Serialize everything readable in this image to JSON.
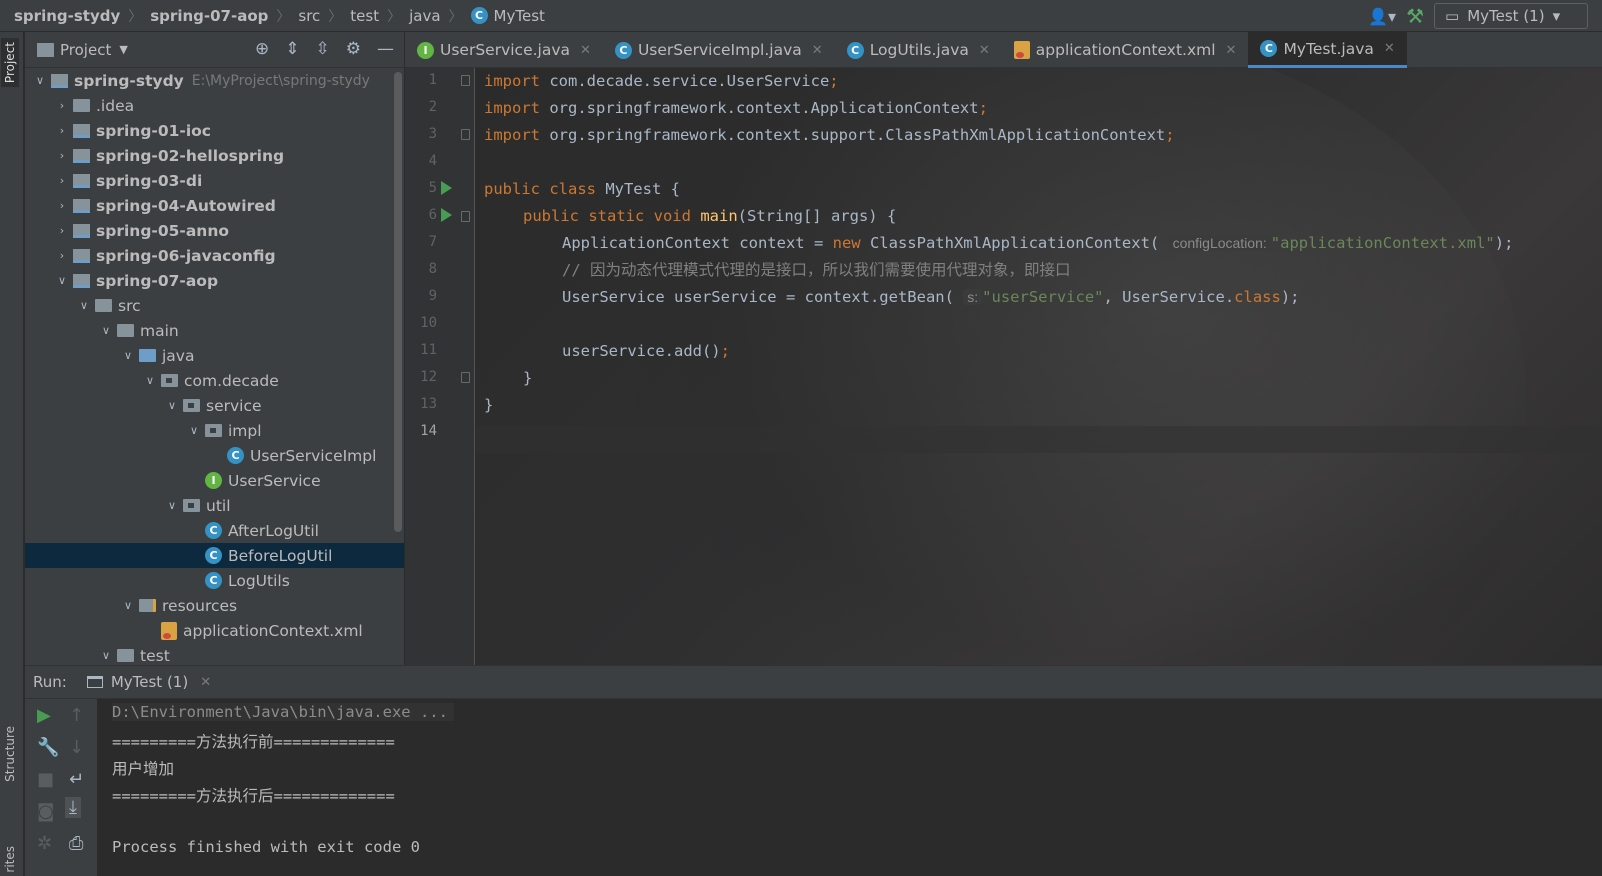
{
  "breadcrumb": {
    "items": [
      "spring-stydy",
      "spring-07-aop",
      "src",
      "test",
      "java",
      "MyTest"
    ]
  },
  "toolbar": {
    "run_config": "MyTest (1)",
    "accent_green": "#59a869"
  },
  "tool_strip": {
    "project_tab": "Project",
    "structure_tab": "Structure",
    "favorites_tab": "rites"
  },
  "project_panel": {
    "title": "Project",
    "root_label": "spring-stydy",
    "root_path": "E:\\MyProject\\spring-stydy",
    "items": [
      {
        "label": ".idea"
      },
      {
        "label": "spring-01-ioc"
      },
      {
        "label": "spring-02-hellospring"
      },
      {
        "label": "spring-03-di"
      },
      {
        "label": "spring-04-Autowired"
      },
      {
        "label": "spring-05-anno"
      },
      {
        "label": "spring-06-javaconfig"
      },
      {
        "label": "spring-07-aop"
      },
      {
        "label": "src"
      },
      {
        "label": "main"
      },
      {
        "label": "java"
      },
      {
        "label": "com.decade"
      },
      {
        "label": "service"
      },
      {
        "label": "impl"
      },
      {
        "label": "UserServiceImpl"
      },
      {
        "label": "UserService"
      },
      {
        "label": "util"
      },
      {
        "label": "AfterLogUtil"
      },
      {
        "label": "BeforeLogUtil"
      },
      {
        "label": "LogUtils"
      },
      {
        "label": "resources"
      },
      {
        "label": "applicationContext.xml"
      },
      {
        "label": "test"
      }
    ]
  },
  "editor_tabs": [
    {
      "label": "UserService.java"
    },
    {
      "label": "UserServiceImpl.java"
    },
    {
      "label": "LogUtils.java"
    },
    {
      "label": "applicationContext.xml"
    },
    {
      "label": "MyTest.java"
    }
  ],
  "gutter": {
    "line_numbers": [
      "1",
      "2",
      "3",
      "4",
      "5",
      "6",
      "7",
      "8",
      "9",
      "10",
      "11",
      "12",
      "13",
      "14"
    ]
  },
  "code": {
    "l1_kw": "import",
    "l1_rest": " com.decade.service.UserService",
    "l2_kw": "import",
    "l2_rest": " org.springframework.context.ApplicationContext",
    "l3_kw": "import",
    "l3_rest": " org.springframework.context.support.ClassPathXmlApplicationContext",
    "semi": ";",
    "l5_kw": "public class",
    "l5_rest": " MyTest {",
    "l6_kw": "public static void",
    "l6_fn": "main",
    "l6_rest": "(String[] args) {",
    "l7_a": "ApplicationContext context = ",
    "l7_new": "new",
    "l7_b": " ClassPathXmlApplicationContext(",
    "l7_hint": "configLocation:",
    "l7_str": "\"applicationContext.xml\"",
    "l7_end": ");",
    "l8_comment": "// 因为动态代理模式代理的是接口，所以我们需要使用代理对象，即接口",
    "l9_a": "UserService userService = context.getBean(",
    "l9_hint": "s:",
    "l9_str": "\"userService\"",
    "l9_b": ", UserService.",
    "l9_kw": "class",
    "l9_end": ");",
    "l11": "userService.add()",
    "l12": "}",
    "l13": "}"
  },
  "run_panel": {
    "label": "Run:",
    "tab": "MyTest (1)",
    "output": [
      "D:\\Environment\\Java\\bin\\java.exe ...",
      "=========方法执行前=============",
      "用户增加",
      "=========方法执行后=============",
      "",
      "Process finished with exit code 0"
    ]
  }
}
